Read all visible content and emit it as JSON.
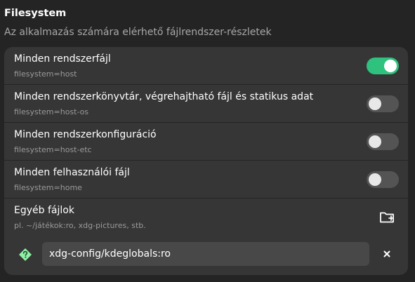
{
  "section": {
    "title": "Filesystem",
    "description": "Az alkalmazás számára elérhető fájlrendszer-részletek"
  },
  "rows": [
    {
      "title": "Minden rendszerfájl",
      "subtitle": "filesystem=host",
      "enabled": true
    },
    {
      "title": "Minden rendszerkönyvtár, végrehajtható fájl és statikus adat",
      "subtitle": "filesystem=host-os",
      "enabled": false
    },
    {
      "title": "Minden rendszerkonfiguráció",
      "subtitle": "filesystem=host-etc",
      "enabled": false
    },
    {
      "title": "Minden felhasználói fájl",
      "subtitle": "filesystem=home",
      "enabled": false
    }
  ],
  "other_files": {
    "title": "Egyéb fájlok",
    "subtitle": "pl. ~/játékok:ro, xdg-pictures, stb.",
    "add_icon": "folder-new-icon"
  },
  "entries": [
    {
      "value": "xdg-config/kdeglobals:ro",
      "status_icon": "question-diamond-icon",
      "remove_icon": "close-icon"
    }
  ],
  "colors": {
    "accent_green": "#2ec27e",
    "warning_diamond": "#8ff0a4",
    "card_bg": "#363636",
    "window_bg": "#242424"
  }
}
